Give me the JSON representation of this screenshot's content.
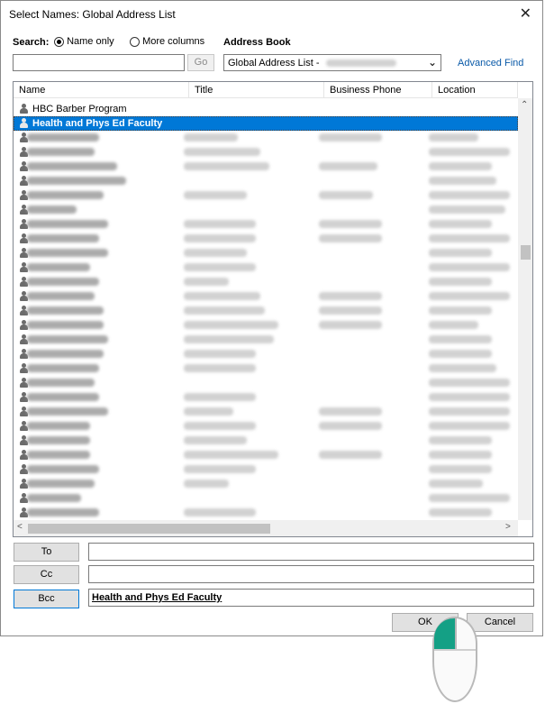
{
  "window": {
    "title": "Select Names: Global Address List",
    "close_glyph": "✕"
  },
  "search": {
    "label": "Search:",
    "option_name_only": "Name only",
    "option_more_columns": "More columns",
    "input_value": "",
    "go_label": "Go"
  },
  "address_book": {
    "label": "Address Book",
    "selected": "Global Address List -",
    "advanced_find": "Advanced Find"
  },
  "columns": [
    "Name",
    "Title",
    "Business Phone",
    "Location"
  ],
  "rows": [
    {
      "name": "HBC Barber Program",
      "selected": false
    },
    {
      "name": "Health and Phys Ed Faculty",
      "selected": true
    }
  ],
  "recipients": {
    "to_label": "To",
    "cc_label": "Cc",
    "bcc_label": "Bcc",
    "to_value": "",
    "cc_value": "",
    "bcc_value": "Health and Phys Ed Faculty"
  },
  "buttons": {
    "ok": "OK",
    "cancel": "Cancel"
  },
  "colors": {
    "selection": "#0078d7",
    "accent_mouse": "#14a085"
  }
}
